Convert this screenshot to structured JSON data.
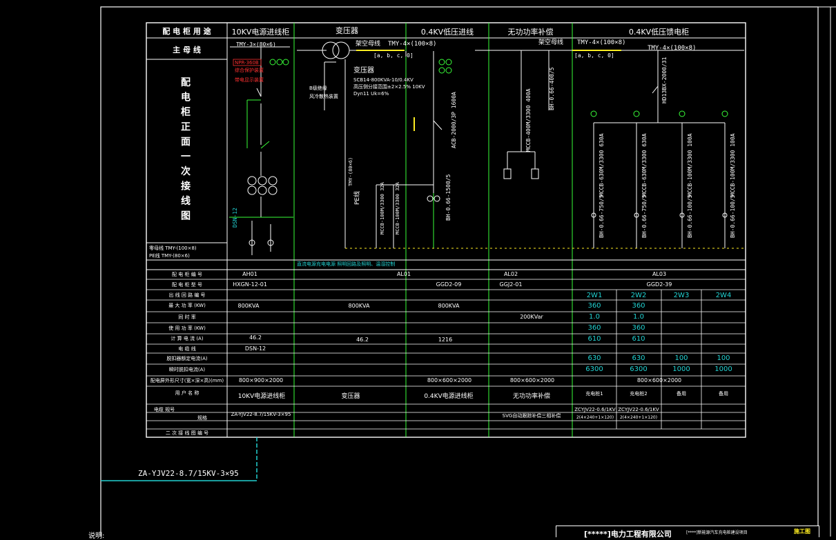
{
  "colors": {
    "background": "#000000",
    "frame": "#ffffff",
    "bus": "#ffffff",
    "green_lines": "#39ff39",
    "cyan_text": "#22d3d3",
    "yellow_bus": "#ffee22",
    "red_labels": "#ff3030"
  },
  "header_left": {
    "usage": "配 电 柜 用 途",
    "main_bus": "主 母 线"
  },
  "title_vertical": [
    "配",
    "电",
    "柜",
    "正",
    "面",
    "一",
    "次",
    "接",
    "线",
    "图"
  ],
  "bus_notes": {
    "neutral": "零母线  TMY-(100×8)",
    "pe": "PE线  TMY-(80×6)"
  },
  "columns": [
    "10KV电源进线柜",
    "变压器",
    "0.4KV低压进线",
    "无功功率补偿",
    "0.4KV低压馈电柜"
  ],
  "diagram": {
    "hv_cable": "TMY-3×(80×6)",
    "npr": "NPR-360B",
    "transformer_label": "变压器",
    "transformer_spec": "SCB14-800KVA-10/0.4KV",
    "bus_bridge": "架空母线",
    "bus_spec_left": "TMY-4×(100×8)",
    "bus_spec_right": "TMY-4×(100×8)",
    "bus_phases_left": "[a, b, c, 0]",
    "bus_phases_right": "[a, b, c, 0]",
    "pe_line": "PE线",
    "tmy_vert": "TMY-(80×6)",
    "breaker_main": "ACB-2000/3P 1600A",
    "ct_main": "BH-0.66-1500/5",
    "mccb_a": "MCCB-100M/3300 32A",
    "mccb_b": "MCCB-100M/3300 32A",
    "comp_breaker": "MCCB-400M/3300 400A",
    "comp_ct": "BH-0.66-400/5",
    "feeder_switch": "HD13BX-2000/31",
    "feeders": [
      {
        "mccb": "MCCB-630M/3300 630A",
        "ct": "BH-0.66-750/5"
      },
      {
        "mccb": "MCCB-630M/3300 630A",
        "ct": "BH-0.66-750/5"
      },
      {
        "mccb": "MCCB-100M/3300 100A",
        "ct": "BH-0.66-100/5"
      },
      {
        "mccb": "MCCB-100M/3300 100A",
        "ct": "BH-0.66-100/5"
      }
    ],
    "dsn": "DSN-12",
    "note_mid": "直流电源充电电源 照明回路及照明、温湿控制"
  },
  "table": {
    "row_labels": [
      "配 电 柜 编 号",
      "配 电 柜 型 号",
      "出 线 回 路 编 号",
      "最 大 功 率 (KW)",
      "同 时 率",
      "使 用 功 率 (KW)",
      "计 算 电 流 (A)",
      "电 缆 线",
      "脱扣器额定电流(A)",
      "瞬时脱扣电流(A)",
      "配电屏外形尺寸(宽×深×高)(mm)",
      "用 户 名 称",
      "电缆 规号",
      "规格",
      "二 次 接 线 图 编 号"
    ],
    "cabinet_no": [
      "AH01",
      "AL01",
      "AL02",
      "AL03"
    ],
    "cabinet_model": [
      "HXGN-12-01",
      "GGD2-09",
      "GGJ2-01",
      "GGD2-39"
    ],
    "circuits": [
      "2W1",
      "2W2",
      "2W3",
      "2W4"
    ],
    "max_power": {
      "c1": "800KVA",
      "c2": "800KVA",
      "c3": "800KVA",
      "f1": "360",
      "f2": "360"
    },
    "simul": {
      "comp": "200KVar",
      "f1": "1.0",
      "f2": "1.0"
    },
    "use_power": {
      "f1": "360",
      "f2": "360"
    },
    "calc_current": {
      "c1": "46.2",
      "c2": "46.2",
      "c3": "1216",
      "f1": "610",
      "f2": "610"
    },
    "cable_line": {
      "c1": "DSN-12"
    },
    "trip_rated": {
      "f1": "630",
      "f2": "630",
      "f3": "100",
      "f4": "100"
    },
    "trip_instant": {
      "f1": "6300",
      "f2": "6300",
      "f3": "1000",
      "f4": "1000"
    },
    "dims": {
      "c1": "800×900×2000",
      "c3": "800×600×2000",
      "comp": "800×600×2000",
      "feed": "800×600×2000"
    },
    "user_names": [
      "10KV电源进线柜",
      "变压器",
      "0.4KV电源进线柜",
      "无功功率补偿",
      "充电桩1",
      "充电桩2",
      "备用",
      "备用"
    ],
    "cable_model": {
      "c1": "ZA-YJV22-8.7/15KV-3×95",
      "comp": "SVG自动跟踪补偿三相补偿",
      "f1": "ZCYJV22-0.6/1KV",
      "f2": "ZCYJV22-0.6/1KV"
    },
    "cable_spec": {
      "f1": "2(4×240+1×120)",
      "f2": "2(4×240+1×120)"
    }
  },
  "cable_callout": "ZA-YJV22-8.7/15KV-3×95",
  "bottom": {
    "note": "说明:",
    "company": "[*****]电力工程有限公司",
    "project": "[****]新能源汽车充电桩建设项目",
    "stamp": "施工图"
  }
}
